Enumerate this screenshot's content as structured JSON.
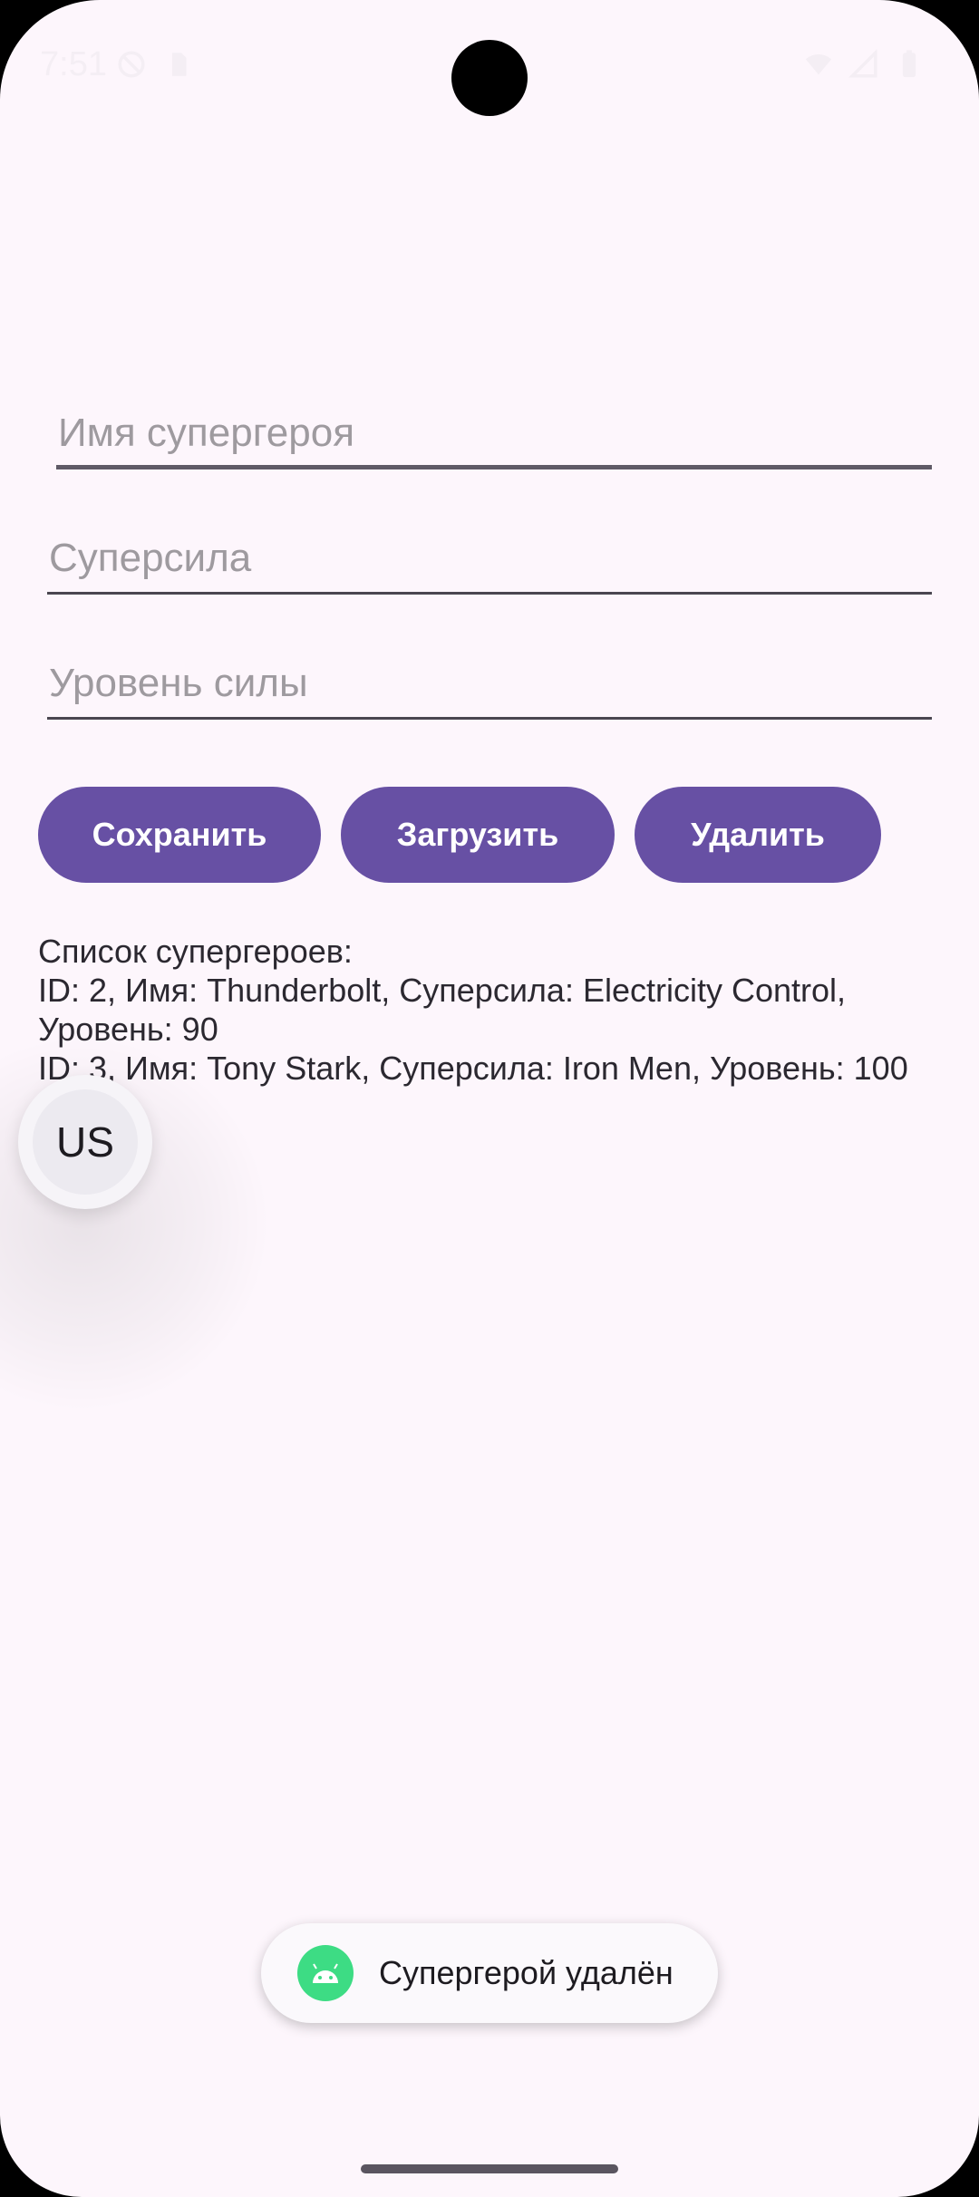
{
  "status_bar": {
    "time": "7:51"
  },
  "form": {
    "name_placeholder": "Имя супергероя",
    "power_placeholder": "Суперсила",
    "level_placeholder": "Уровень силы"
  },
  "buttons": {
    "save": "Сохранить",
    "load": "Загрузить",
    "delete": "Удалить"
  },
  "hero_list": {
    "header": "Список супергероев:",
    "lines": [
      "ID: 2, Имя: Thunderbolt, Суперсила: Electricity Control,",
      "Уровень: 90",
      "ID: 3, Имя: Tony Stark, Суперсила: Iron Men, Уровень: 100"
    ]
  },
  "floating_button": {
    "label": "US"
  },
  "toast": {
    "message": "Супергерой удалён",
    "icon": "android-icon"
  },
  "colors": {
    "background": "#fdf6fc",
    "primary": "#6750a4",
    "toast_icon": "#3ddc84"
  }
}
